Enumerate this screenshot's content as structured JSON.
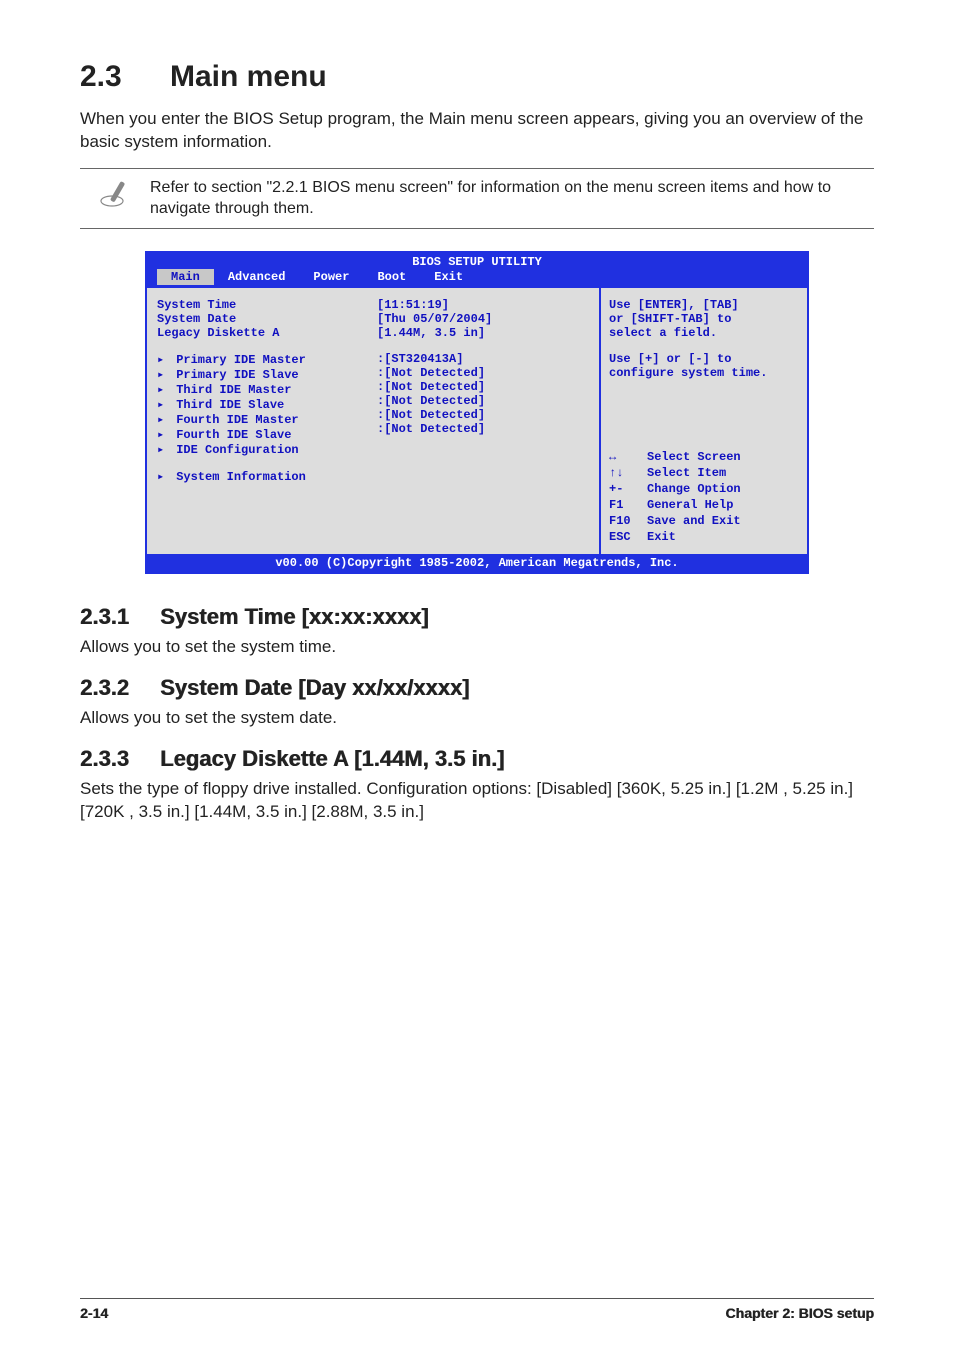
{
  "section": {
    "number": "2.3",
    "title": "Main menu"
  },
  "intro": "When you enter the BIOS Setup program, the Main menu screen appears, giving you an overview of the basic system information.",
  "note": "Refer to section \"2.2.1  BIOS menu screen\" for information on the menu screen items and how to navigate through them.",
  "bios": {
    "title": "BIOS SETUP UTILITY",
    "tabs": [
      "Main",
      "Advanced",
      "Power",
      "Boot",
      "Exit"
    ],
    "active_tab": "Main",
    "fields": [
      {
        "label": "System Time",
        "value": "[11:51:19]",
        "sub": false
      },
      {
        "label": "System Date",
        "value": "[Thu 05/07/2004]",
        "sub": false
      },
      {
        "label": "Legacy Diskette A",
        "value": "[1.44M, 3.5 in]",
        "sub": false
      }
    ],
    "sub_items": [
      {
        "label": "Primary IDE Master",
        "value": ":[ST320413A]"
      },
      {
        "label": "Primary IDE Slave",
        "value": ":[Not Detected]"
      },
      {
        "label": "Third IDE Master",
        "value": ":[Not Detected]"
      },
      {
        "label": "Third IDE Slave",
        "value": ":[Not Detected]"
      },
      {
        "label": "Fourth IDE Master",
        "value": ":[Not Detected]"
      },
      {
        "label": "Fourth IDE Slave",
        "value": ":[Not Detected]"
      },
      {
        "label": "IDE Configuration",
        "value": ""
      }
    ],
    "extra_item": {
      "label": "System Information",
      "value": ""
    },
    "help": {
      "line1": "Use [ENTER], [TAB]",
      "line2": "or [SHIFT-TAB] to",
      "line3": "select a field.",
      "line4": "Use [+] or [-] to",
      "line5": "configure system time.",
      "keys": [
        {
          "k": "↔",
          "d": "Select Screen"
        },
        {
          "k": "↑↓",
          "d": "Select Item"
        },
        {
          "k": "+-",
          "d": "Change Option"
        },
        {
          "k": "F1",
          "d": "General Help"
        },
        {
          "k": "F10",
          "d": "Save and Exit"
        },
        {
          "k": "ESC",
          "d": "Exit"
        }
      ]
    },
    "footer": "v00.00 (C)Copyright 1985-2002, American Megatrends, Inc."
  },
  "subsections": {
    "s1": {
      "num": "2.3.1",
      "title": "System Time [xx:xx:xxxx]",
      "body": "Allows you to set the system time."
    },
    "s2": {
      "num": "2.3.2",
      "title": "System Date [Day xx/xx/xxxx]",
      "body": "Allows you to set the system date."
    },
    "s3": {
      "num": "2.3.3",
      "title": "Legacy Diskette A [1.44M, 3.5 in.]",
      "body": "Sets the type of floppy drive installed. Configuration options: [Disabled] [360K, 5.25 in.] [1.2M , 5.25 in.] [720K , 3.5 in.] [1.44M, 3.5 in.] [2.88M, 3.5 in.]"
    }
  },
  "page_footer": {
    "left": "2-14",
    "right": "Chapter 2: BIOS setup"
  }
}
